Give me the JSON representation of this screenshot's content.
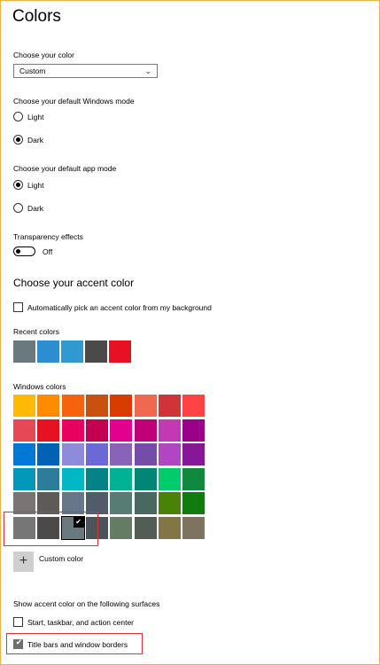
{
  "title": "Colors",
  "choose_color": {
    "label": "Choose your color",
    "selected": "Custom"
  },
  "windows_mode": {
    "label": "Choose your default Windows mode",
    "options": [
      {
        "label": "Light",
        "selected": false
      },
      {
        "label": "Dark",
        "selected": true
      }
    ]
  },
  "app_mode": {
    "label": "Choose your default app mode",
    "options": [
      {
        "label": "Light",
        "selected": true
      },
      {
        "label": "Dark",
        "selected": false
      }
    ]
  },
  "transparency": {
    "label": "Transparency effects",
    "state": "Off"
  },
  "accent": {
    "heading": "Choose your accent color",
    "auto_pick": {
      "label": "Automatically pick an accent color from my background",
      "checked": false
    },
    "recent_label": "Recent colors",
    "recent_colors": [
      "#69797e",
      "#2d8ecf",
      "#2e9ad0",
      "#4c4a48",
      "#e81123"
    ],
    "windows_label": "Windows colors",
    "windows_colors": [
      [
        "#ffb900",
        "#ff8c00",
        "#f7630c",
        "#ca5010",
        "#da3b01",
        "#ef6950",
        "#d13438",
        "#ff4343"
      ],
      [
        "#e74856",
        "#e81123",
        "#ea005e",
        "#c30052",
        "#e3008c",
        "#bf0077",
        "#c239b3",
        "#9a0089"
      ],
      [
        "#0078d7",
        "#0063b1",
        "#8e8cd8",
        "#6b69d6",
        "#8764b8",
        "#744da9",
        "#b146c2",
        "#881798"
      ],
      [
        "#0099bc",
        "#2d7d9a",
        "#00b7c3",
        "#038387",
        "#00b294",
        "#018574",
        "#00cc6a",
        "#10893e"
      ],
      [
        "#7a7574",
        "#5d5a58",
        "#68768a",
        "#515c6b",
        "#567c73",
        "#486860",
        "#498205",
        "#107c10"
      ],
      [
        "#767676",
        "#4c4a48",
        "#69797e",
        "#4a5459",
        "#647c64",
        "#525e54",
        "#847545",
        "#7e735f"
      ]
    ],
    "selected_swatch": [
      5,
      2
    ],
    "custom_label": "Custom color"
  },
  "surfaces": {
    "label": "Show accent color on the following surfaces",
    "options": [
      {
        "label": "Start, taskbar, and action center",
        "checked": false
      },
      {
        "label": "Title bars and window borders",
        "checked": true
      }
    ]
  },
  "colors": {
    "frame": "#f0b341",
    "highlight": "#e03030"
  }
}
